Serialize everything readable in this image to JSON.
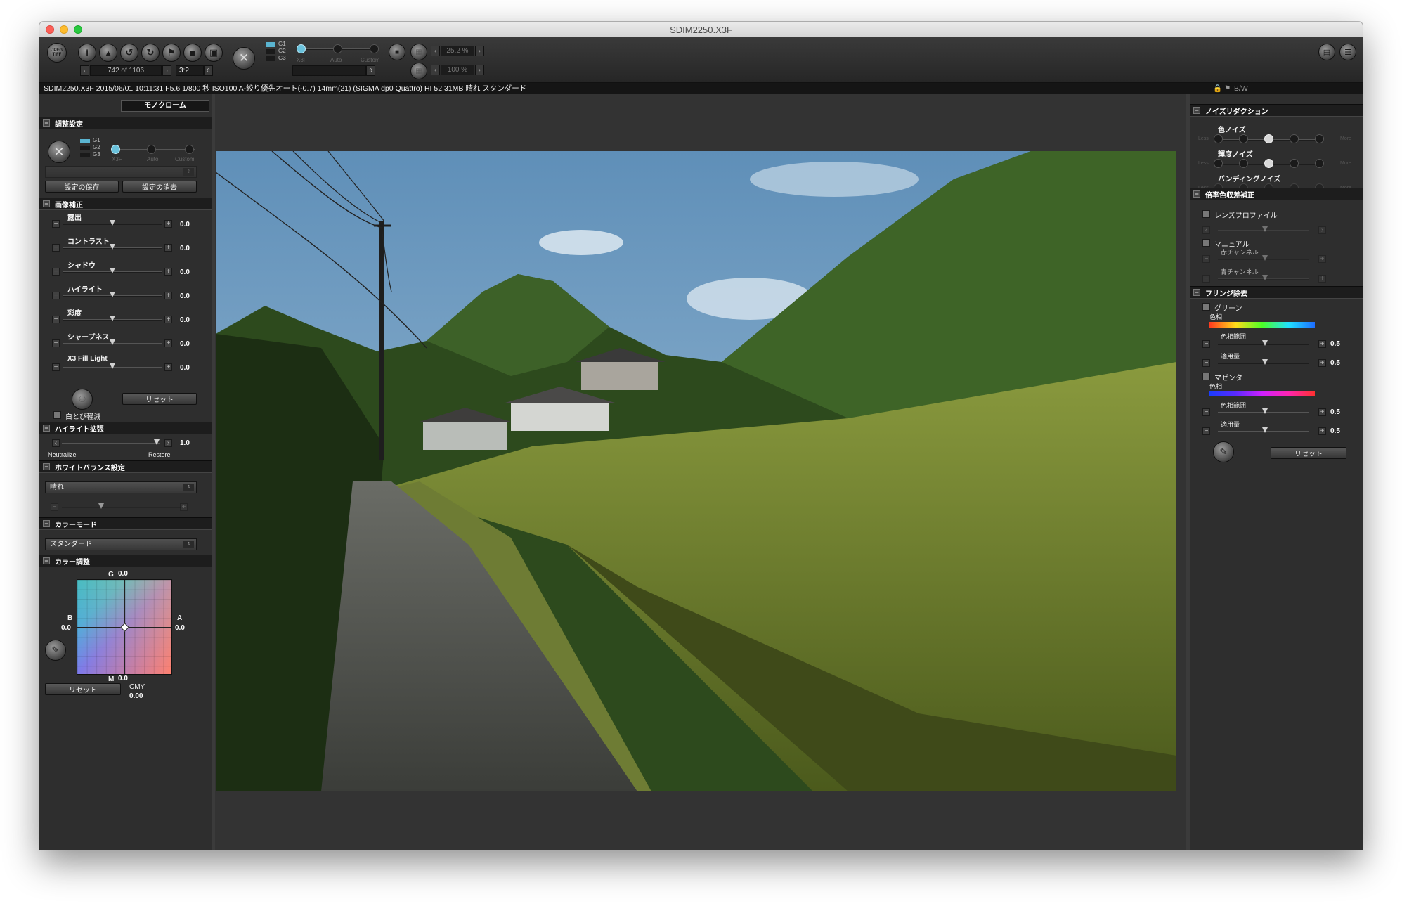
{
  "window": {
    "title": "SDIM2250.X3F"
  },
  "toolbar": {
    "format_button": "JPEG TIFF",
    "info_icon": "i",
    "nav": {
      "counter": "742 of 1106",
      "ratio": "3:2"
    },
    "preset_slider": {
      "labels": [
        "G1",
        "G2",
        "G3"
      ],
      "stops": [
        "X3F",
        "Auto",
        "Custom"
      ]
    },
    "zoom": {
      "field1": "25.2 %",
      "field2": "100 %"
    }
  },
  "info_line": "SDIM2250.X3F 2015/06/01 10:11:31 F5.6 1/800 秒 ISO100 A-絞り優先オート(-0.7) 14mm(21) (SIGMA dp0 Quattro) HI 52.31MB 晴れ スタンダード",
  "right_info": "B/W",
  "left": {
    "mode_tab": "モノクローム",
    "settings": {
      "title": "調整設定",
      "g_labels": [
        "G1",
        "G2",
        "G3"
      ],
      "stops": [
        "X3F",
        "Auto",
        "Custom"
      ],
      "save": "設定の保存",
      "delete": "設定の消去"
    },
    "correction": {
      "title": "画像補正",
      "rows": [
        {
          "label": "露出",
          "value": "0.0"
        },
        {
          "label": "コントラスト",
          "value": "0.0"
        },
        {
          "label": "シャドウ",
          "value": "0.0"
        },
        {
          "label": "ハイライト",
          "value": "0.0"
        },
        {
          "label": "彩度",
          "value": "0.0"
        },
        {
          "label": "シャープネス",
          "value": "0.0"
        },
        {
          "label": "X3 Fill Light",
          "value": "0.0"
        }
      ],
      "reset": "リセット",
      "whiteout": "白とび軽減"
    },
    "highlight": {
      "title": "ハイライト拡張",
      "value": "1.0",
      "left": "Neutralize",
      "right": "Restore"
    },
    "wb": {
      "title": "ホワイトバランス設定",
      "selected": "晴れ"
    },
    "colormode": {
      "title": "カラーモード",
      "selected": "スタンダード"
    },
    "coloradj": {
      "title": "カラー調整",
      "g": "G",
      "g_val": "0.0",
      "b": "B",
      "b_val": "0.0",
      "a": "A",
      "a_val": "0.0",
      "m": "M",
      "m_val": "0.0",
      "reset": "リセット",
      "cmy": "CMY",
      "cmy_val": "0.00"
    }
  },
  "right": {
    "noise": {
      "title": "ノイズリダクション",
      "rows": [
        {
          "label": "色ノイズ",
          "low": "Less",
          "high": "More",
          "level": 3
        },
        {
          "label": "輝度ノイズ",
          "low": "Less",
          "high": "More",
          "level": 3
        },
        {
          "label": "バンディングノイズ",
          "low": "Less",
          "high": "More",
          "level": 0
        }
      ]
    },
    "aberration": {
      "title": "倍率色収差補正",
      "lens_profile": "レンズプロファイル",
      "manual": "マニュアル",
      "red": "赤チャンネル",
      "blue": "青チャンネル"
    },
    "fringe": {
      "title": "フリンジ除去",
      "green": "グリーン",
      "magenta": "マゼンタ",
      "hue": "色相",
      "hue_range": "色相範囲",
      "amount": "適用量",
      "green_range_val": "0.5",
      "green_amount_val": "0.5",
      "magenta_range_val": "0.5",
      "magenta_amount_val": "0.5",
      "reset": "リセット"
    }
  }
}
